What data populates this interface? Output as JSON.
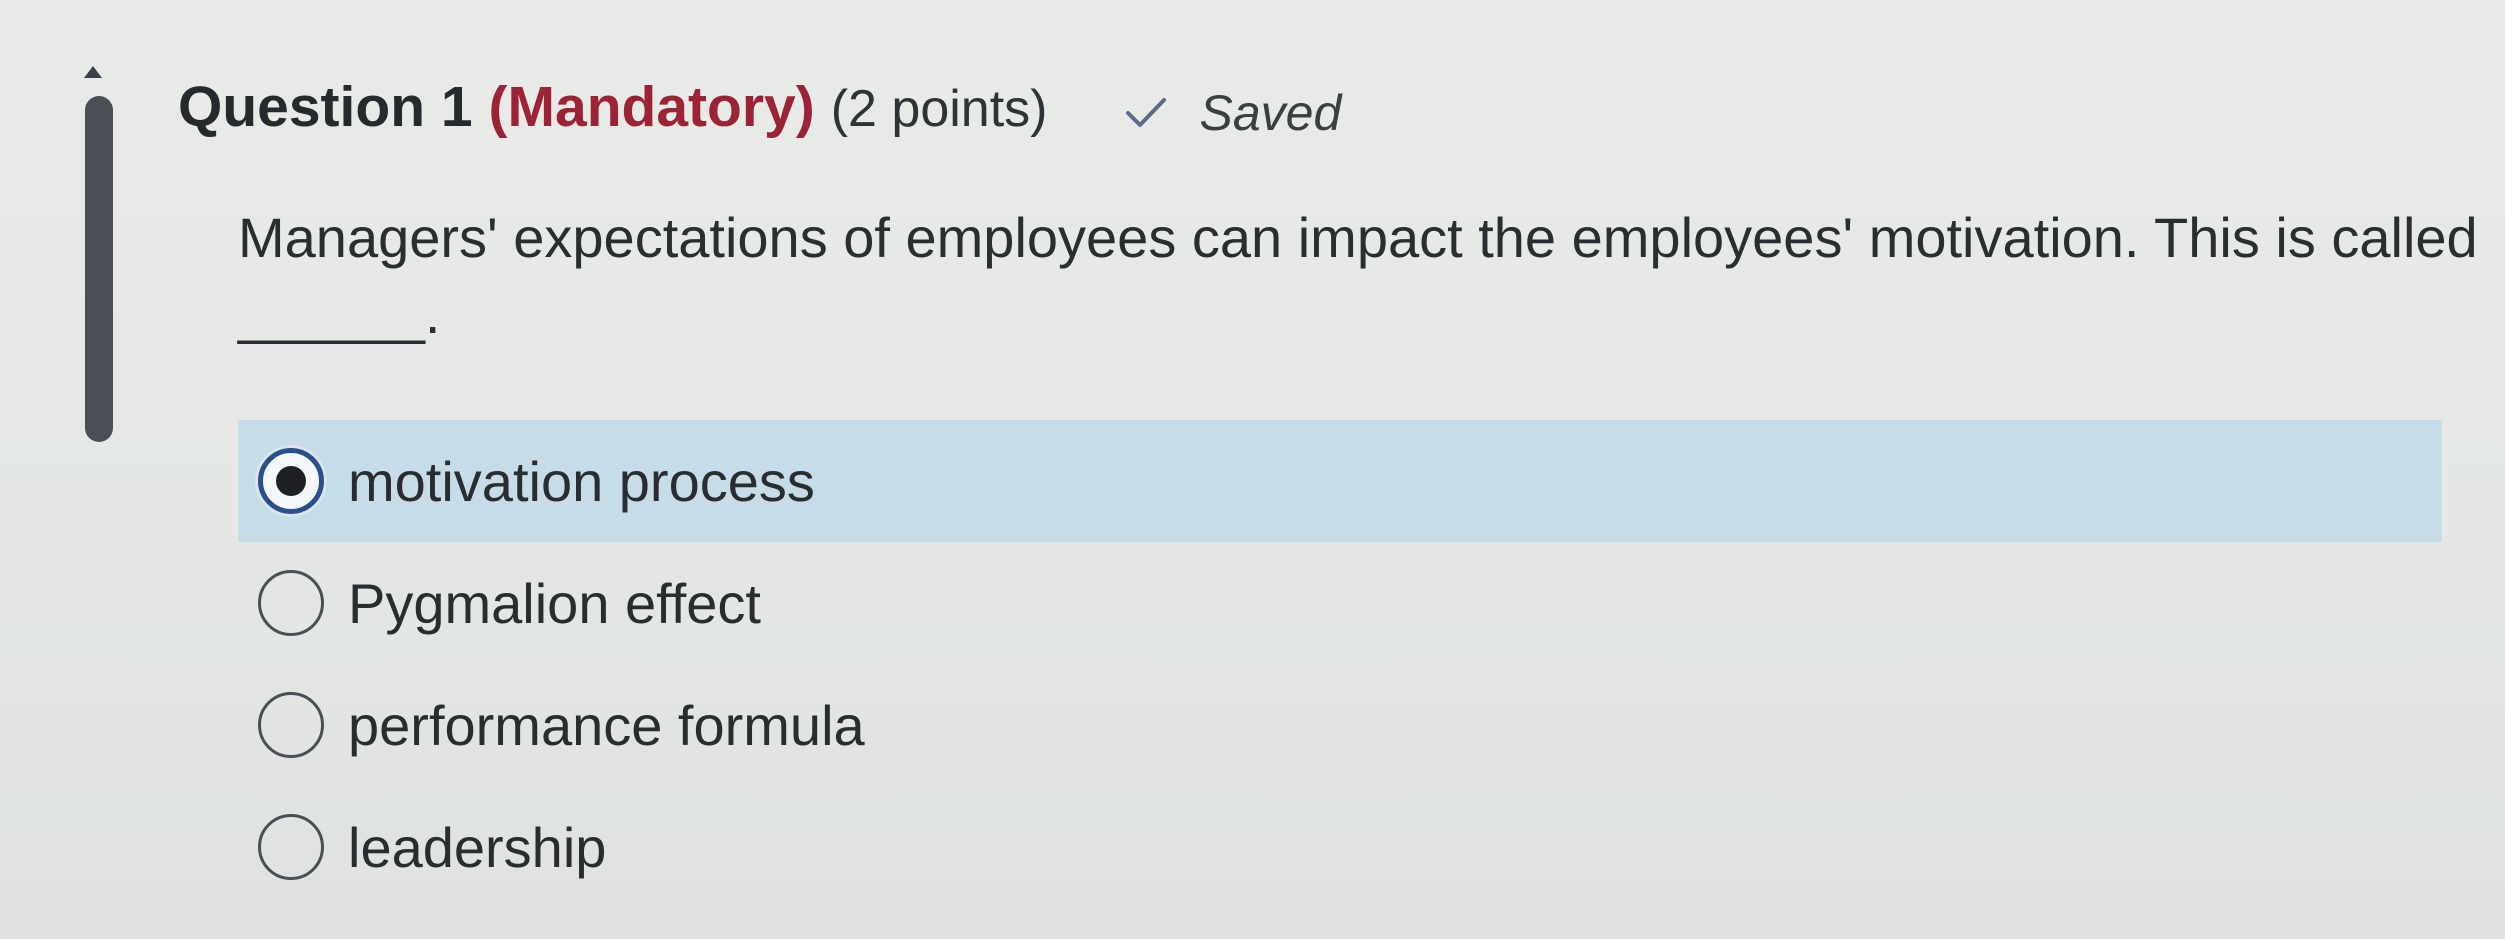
{
  "question": {
    "title": "Question 1",
    "mandatory": "(Mandatory)",
    "points": "(2 points)",
    "status": "Saved",
    "text": "Managers' expectations of employees can impact the employees' motivation. This is called ______."
  },
  "options": [
    {
      "label": "motivation process",
      "selected": true
    },
    {
      "label": "Pygmalion effect",
      "selected": false
    },
    {
      "label": "performance formula",
      "selected": false
    },
    {
      "label": "leadership",
      "selected": false
    }
  ],
  "colors": {
    "mandatory": "#9b2335",
    "selected_row": "#c6dce6",
    "radio_selected_border": "#2b4f8a"
  },
  "icons": {
    "status": "checkmark-icon",
    "scroll": "scroll-up-arrow-icon"
  }
}
